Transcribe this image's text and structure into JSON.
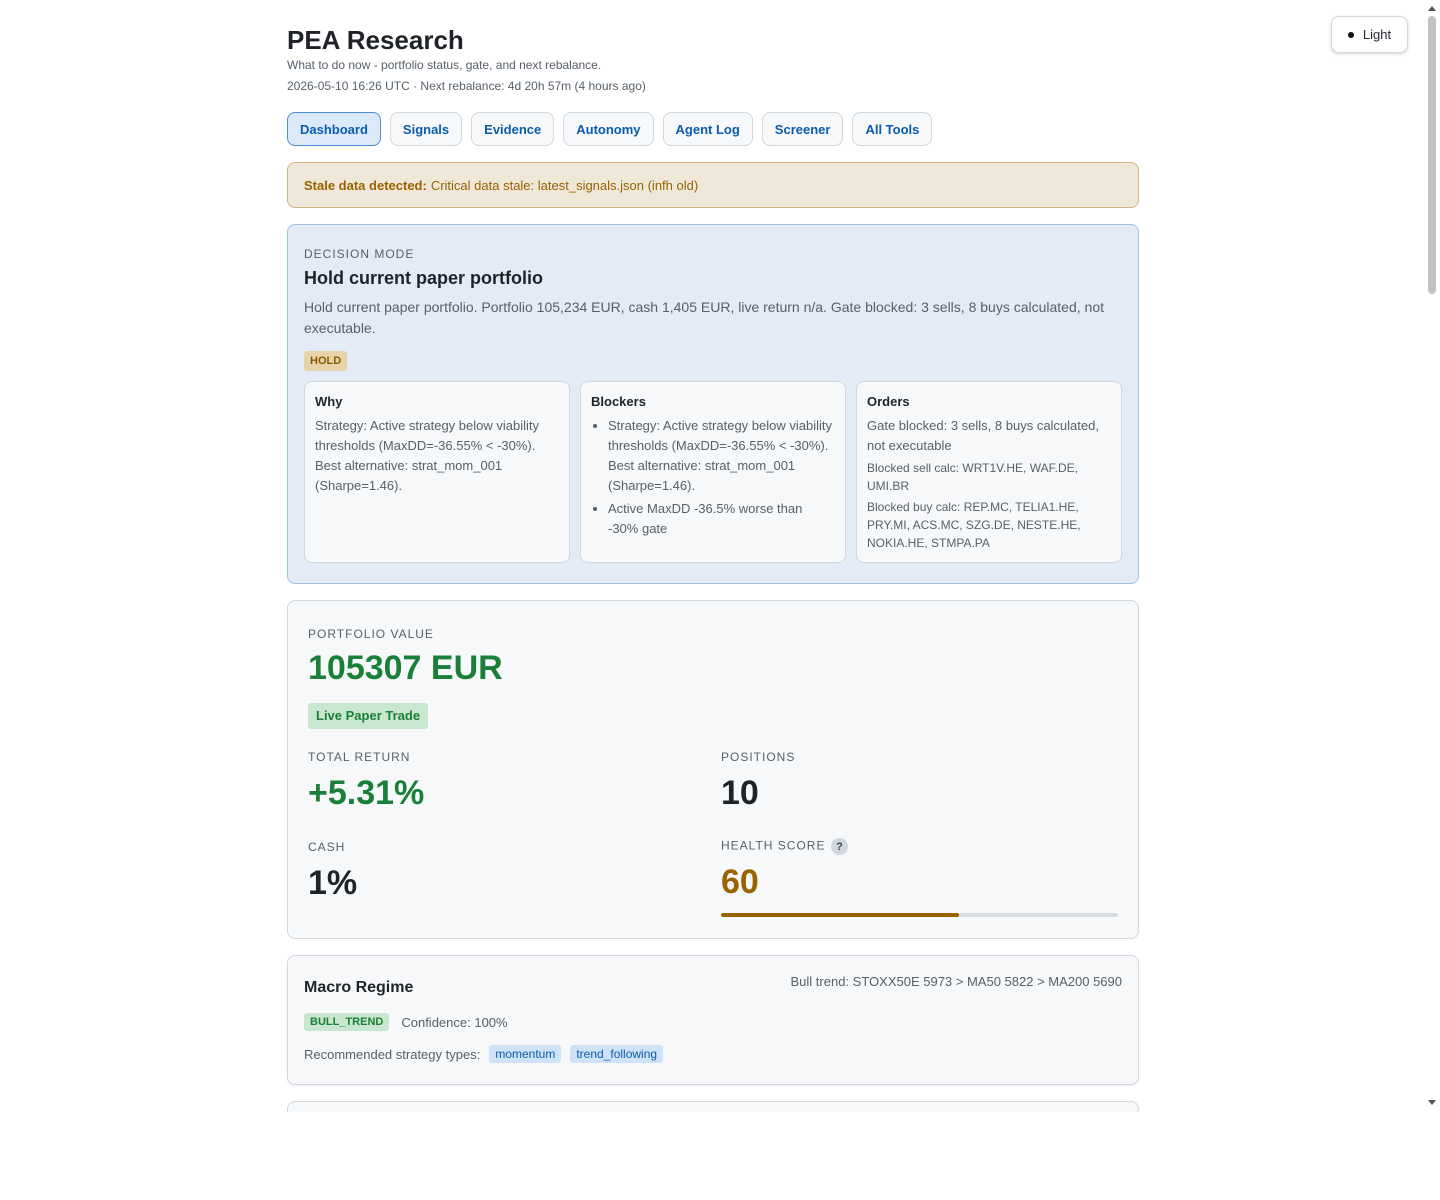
{
  "header": {
    "title": "PEA Research",
    "subtitle": "What to do now - portfolio status, gate, and next rebalance.",
    "timestamp": "2026-05-10 16:26 UTC · Next rebalance: 4d 20h 57m (4 hours ago)"
  },
  "theme_toggle": {
    "label": "Light"
  },
  "nav": {
    "tabs": [
      {
        "label": "Dashboard",
        "active": true
      },
      {
        "label": "Signals"
      },
      {
        "label": "Evidence"
      },
      {
        "label": "Autonomy"
      },
      {
        "label": "Agent Log"
      },
      {
        "label": "Screener"
      },
      {
        "label": "All Tools"
      }
    ]
  },
  "alert": {
    "strong": "Stale data detected:",
    "text": "Critical data stale: latest_signals.json (infh old)"
  },
  "decision": {
    "eyebrow": "DECISION MODE",
    "title": "Hold current paper portfolio",
    "text": "Hold current paper portfolio. Portfolio 105,234 EUR, cash 1,405 EUR, live return n/a. Gate blocked: 3 sells, 8 buys calculated, not executable.",
    "badge": "HOLD",
    "why": {
      "title": "Why",
      "text": "Strategy: Active strategy below viability thresholds (MaxDD=-36.55% < -30%). Best alternative: strat_mom_001 (Sharpe=1.46)."
    },
    "blockers": {
      "title": "Blockers",
      "items": [
        "Strategy: Active strategy below viability thresholds (MaxDD=-36.55% < -30%). Best alternative: strat_mom_001 (Sharpe=1.46).",
        "Active MaxDD -36.5% worse than -30% gate"
      ]
    },
    "orders": {
      "title": "Orders",
      "text": "Gate blocked: 3 sells, 8 buys calculated, not executable",
      "sell_note": "Blocked sell calc: WRT1V.HE, WAF.DE, UMI.BR",
      "buy_note": "Blocked buy calc: REP.MC, TELIA1.HE, PRY.MI, ACS.MC, SZG.DE, NESTE.HE, NOKIA.HE, STMPA.PA"
    }
  },
  "portfolio": {
    "eyebrow": "PORTFOLIO VALUE",
    "value": "105307 EUR",
    "badge": "Live Paper Trade",
    "total_return": {
      "label": "TOTAL RETURN",
      "value": "+5.31%"
    },
    "positions": {
      "label": "POSITIONS",
      "value": "10"
    },
    "cash": {
      "label": "CASH",
      "value": "1%"
    },
    "health": {
      "label": "HEALTH SCORE",
      "value": "60",
      "fraction": 0.6,
      "help": "?"
    }
  },
  "macro": {
    "title": "Macro Regime",
    "trend": "Bull trend: STOXX50E 5973 > MA50 5822 > MA200 5690",
    "badge": "BULL_TREND",
    "confidence": "Confidence: 100%",
    "recommended_label": "Recommended strategy types:",
    "chips": [
      "momentum",
      "trend_following"
    ]
  },
  "colors": {
    "accent": "#0b5cad",
    "positive": "#1a7f37",
    "warning": "#9a6200"
  }
}
